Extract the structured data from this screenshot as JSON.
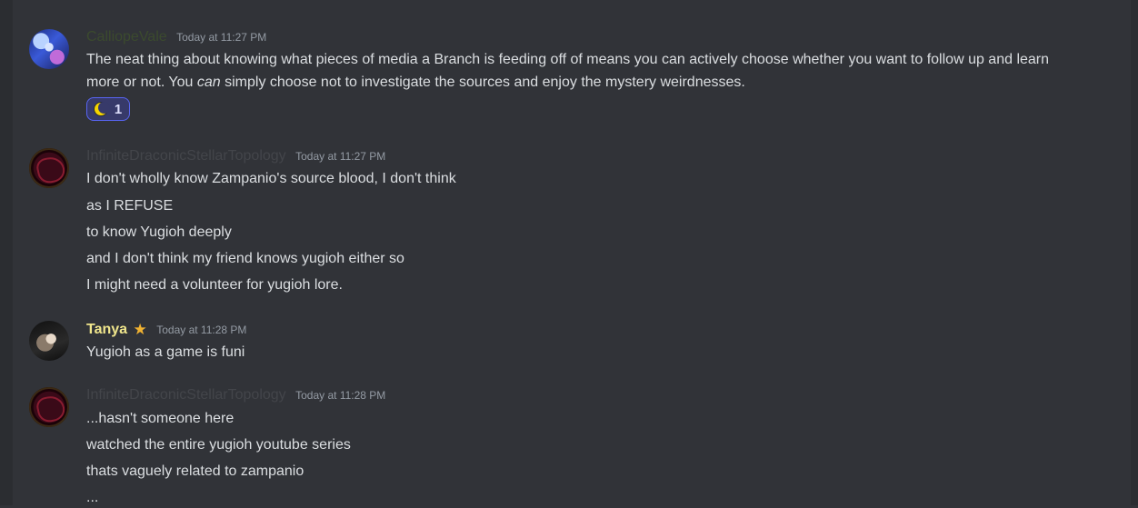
{
  "messages": [
    {
      "author": "CalliopeVale",
      "author_color": "#3b4a2e",
      "timestamp": "Today at 11:27 PM",
      "lines": [
        "The neat thing about knowing what pieces of media a Branch is feeding off of means you can actively choose whether you want to follow up and learn",
        "more or not. You ",
        "can",
        " simply choose not to investigate the sources and enjoy the mystery weirdnesses."
      ],
      "reaction": {
        "emoji": "crescent-moon-icon",
        "count": "1"
      }
    },
    {
      "author": "InfiniteDraconicStellarTopology",
      "author_color": "#43454a",
      "timestamp": "Today at 11:27 PM",
      "lines": [
        "I don't wholly know Zampanio's source blood, I don't think",
        "as I REFUSE",
        "to know Yugioh deeply",
        "and I don't think my friend knows yugioh either so",
        "I might need a volunteer for yugioh lore."
      ]
    },
    {
      "author": "Tanya",
      "author_color": "#f0e68c",
      "badge": "star-icon",
      "timestamp": "Today at 11:28 PM",
      "lines": [
        "Yugioh as a game is funi"
      ]
    },
    {
      "author": "InfiniteDraconicStellarTopology",
      "author_color": "#43454a",
      "timestamp": "Today at 11:28 PM",
      "lines": [
        "...hasn't someone here",
        "watched the entire yugioh youtube series",
        "thats vaguely related to zampanio",
        "..."
      ]
    }
  ]
}
